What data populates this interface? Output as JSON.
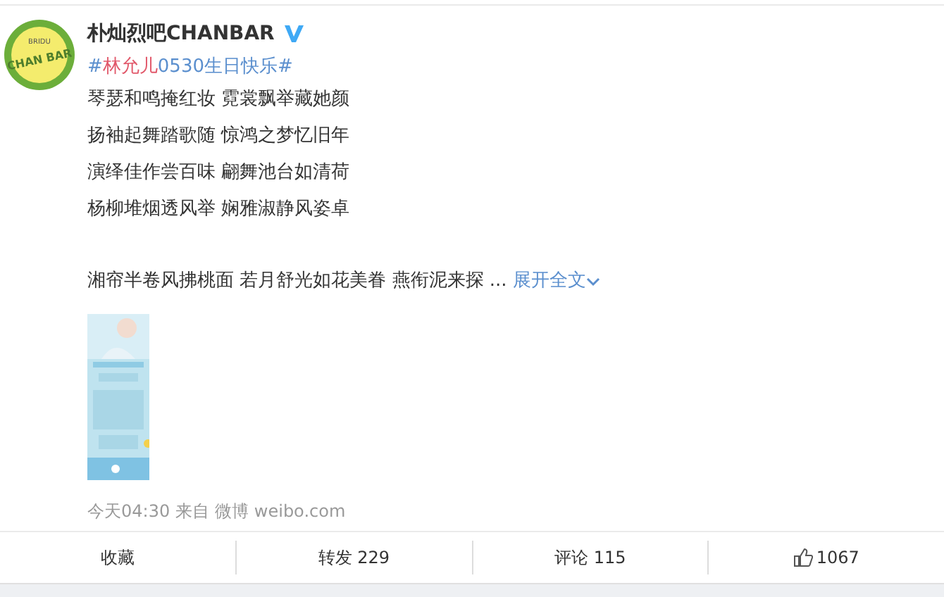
{
  "author": {
    "name": "朴灿烈吧CHANBAR",
    "verified": true,
    "logo_top": "BRIDU",
    "logo_main": "CHAN BAR"
  },
  "hashtag": {
    "lead": "#",
    "highlight": "林允儿",
    "rest": "0530生日快乐#"
  },
  "lines": [
    "琴瑟和鸣掩红妆 霓裳飘举藏她颜",
    "扬袖起舞踏歌随 惊鸿之梦忆旧年",
    "演绎佳作尝百味 翩舞池台如清荷",
    "杨柳堆烟透风举 娴雅淑静风姿卓"
  ],
  "last_line": "湘帘半卷风拂桃面 若月舒光如花美眷 燕衔泥来探 ...",
  "expand": "展开全文",
  "meta": {
    "time": "今天04:30",
    "from": "来自",
    "source": "微博 weibo.com"
  },
  "actions": [
    {
      "kind": "text",
      "label": "收藏"
    },
    {
      "kind": "text",
      "label": "转发 229"
    },
    {
      "kind": "text",
      "label": "评论 115"
    },
    {
      "kind": "like",
      "label": "1067"
    }
  ]
}
